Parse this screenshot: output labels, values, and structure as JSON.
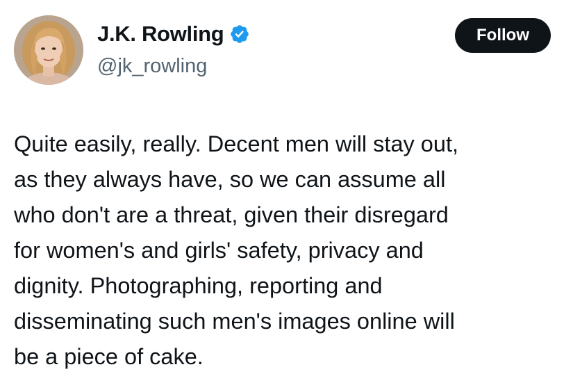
{
  "author": {
    "display_name": "J.K. Rowling",
    "handle": "@jk_rowling",
    "verified": true,
    "verified_color": "#1d9bf0",
    "avatar_icon": "profile-photo"
  },
  "actions": {
    "follow_label": "Follow"
  },
  "tweet": {
    "lines": [
      "Quite easily, really. Decent men will stay out,",
      "as they always have, so we can assume all",
      "who don't are a threat, given their disregard",
      "for women's and girls' safety, privacy and",
      "dignity. Photographing, reporting and",
      "disseminating such men's images online will",
      "be a piece of cake."
    ]
  },
  "colors": {
    "text": "#0f1419",
    "secondary_text": "#536471",
    "button_bg": "#0f1419",
    "button_text": "#ffffff"
  }
}
